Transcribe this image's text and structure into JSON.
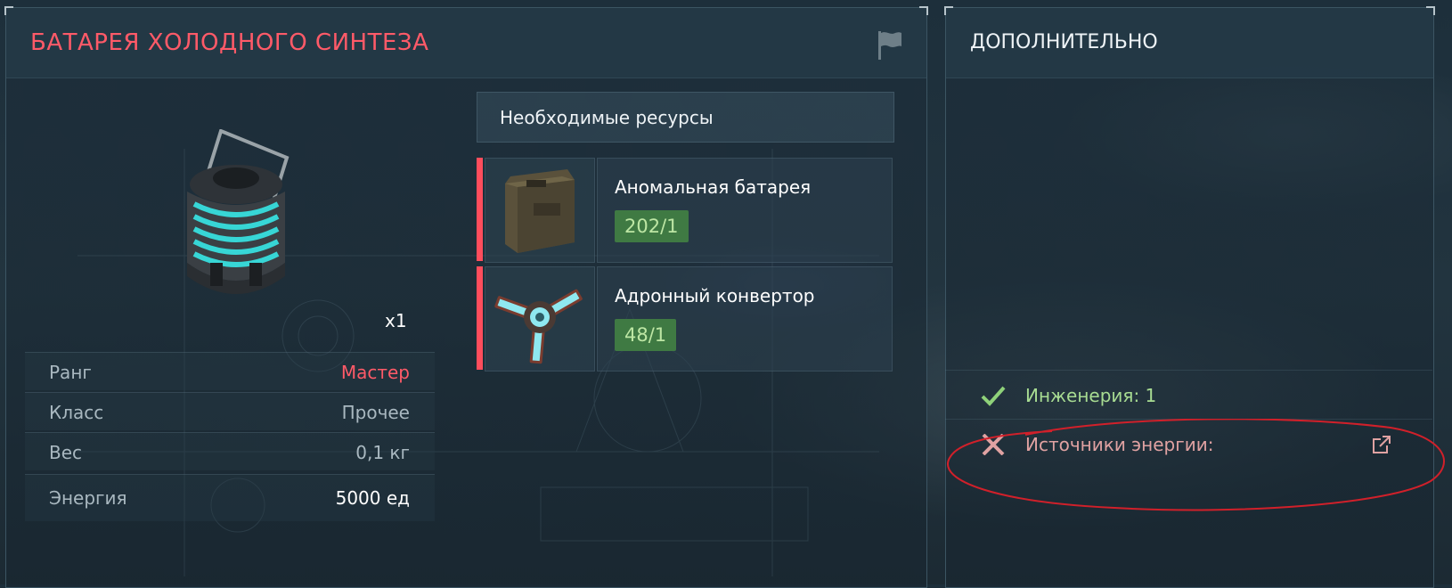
{
  "left_panel": {
    "title": "БАТАРЕЯ ХОЛОДНОГО СИНТЕЗА",
    "flag_icon": "flag-icon",
    "item": {
      "image_icon": "cold-fusion-battery-icon",
      "quantity": "x1"
    },
    "stats": [
      {
        "label": "Ранг",
        "value": "Мастер"
      },
      {
        "label": "Класс",
        "value": "Прочее"
      },
      {
        "label": "Вес",
        "value": "0,1 кг"
      },
      {
        "label": "Энергия",
        "value": "5000 ед"
      }
    ],
    "required": {
      "header": "Необходимые ресурсы",
      "items": [
        {
          "name": "Аномальная батарея",
          "count": "202/1",
          "icon": "anomalous-battery-icon"
        },
        {
          "name": "Адронный конвертор",
          "count": "48/1",
          "icon": "hadron-converter-icon"
        }
      ]
    }
  },
  "right_panel": {
    "title": "ДОПОЛНИТЕЛЬНО",
    "requirements": [
      {
        "text": "Инженерия: 1",
        "status": "met",
        "icon": "check-icon"
      },
      {
        "text": "Источники энергии:",
        "status": "unmet",
        "icon": "cross-icon",
        "link_icon": "external-link-icon"
      }
    ]
  },
  "colors": {
    "accent_red": "#ff5a68",
    "count_bg": "#3f7a43",
    "count_text": "#bde6a4",
    "met": "#a8dc92",
    "unmet": "#e0a2a2",
    "annotation": "#d1202a"
  }
}
